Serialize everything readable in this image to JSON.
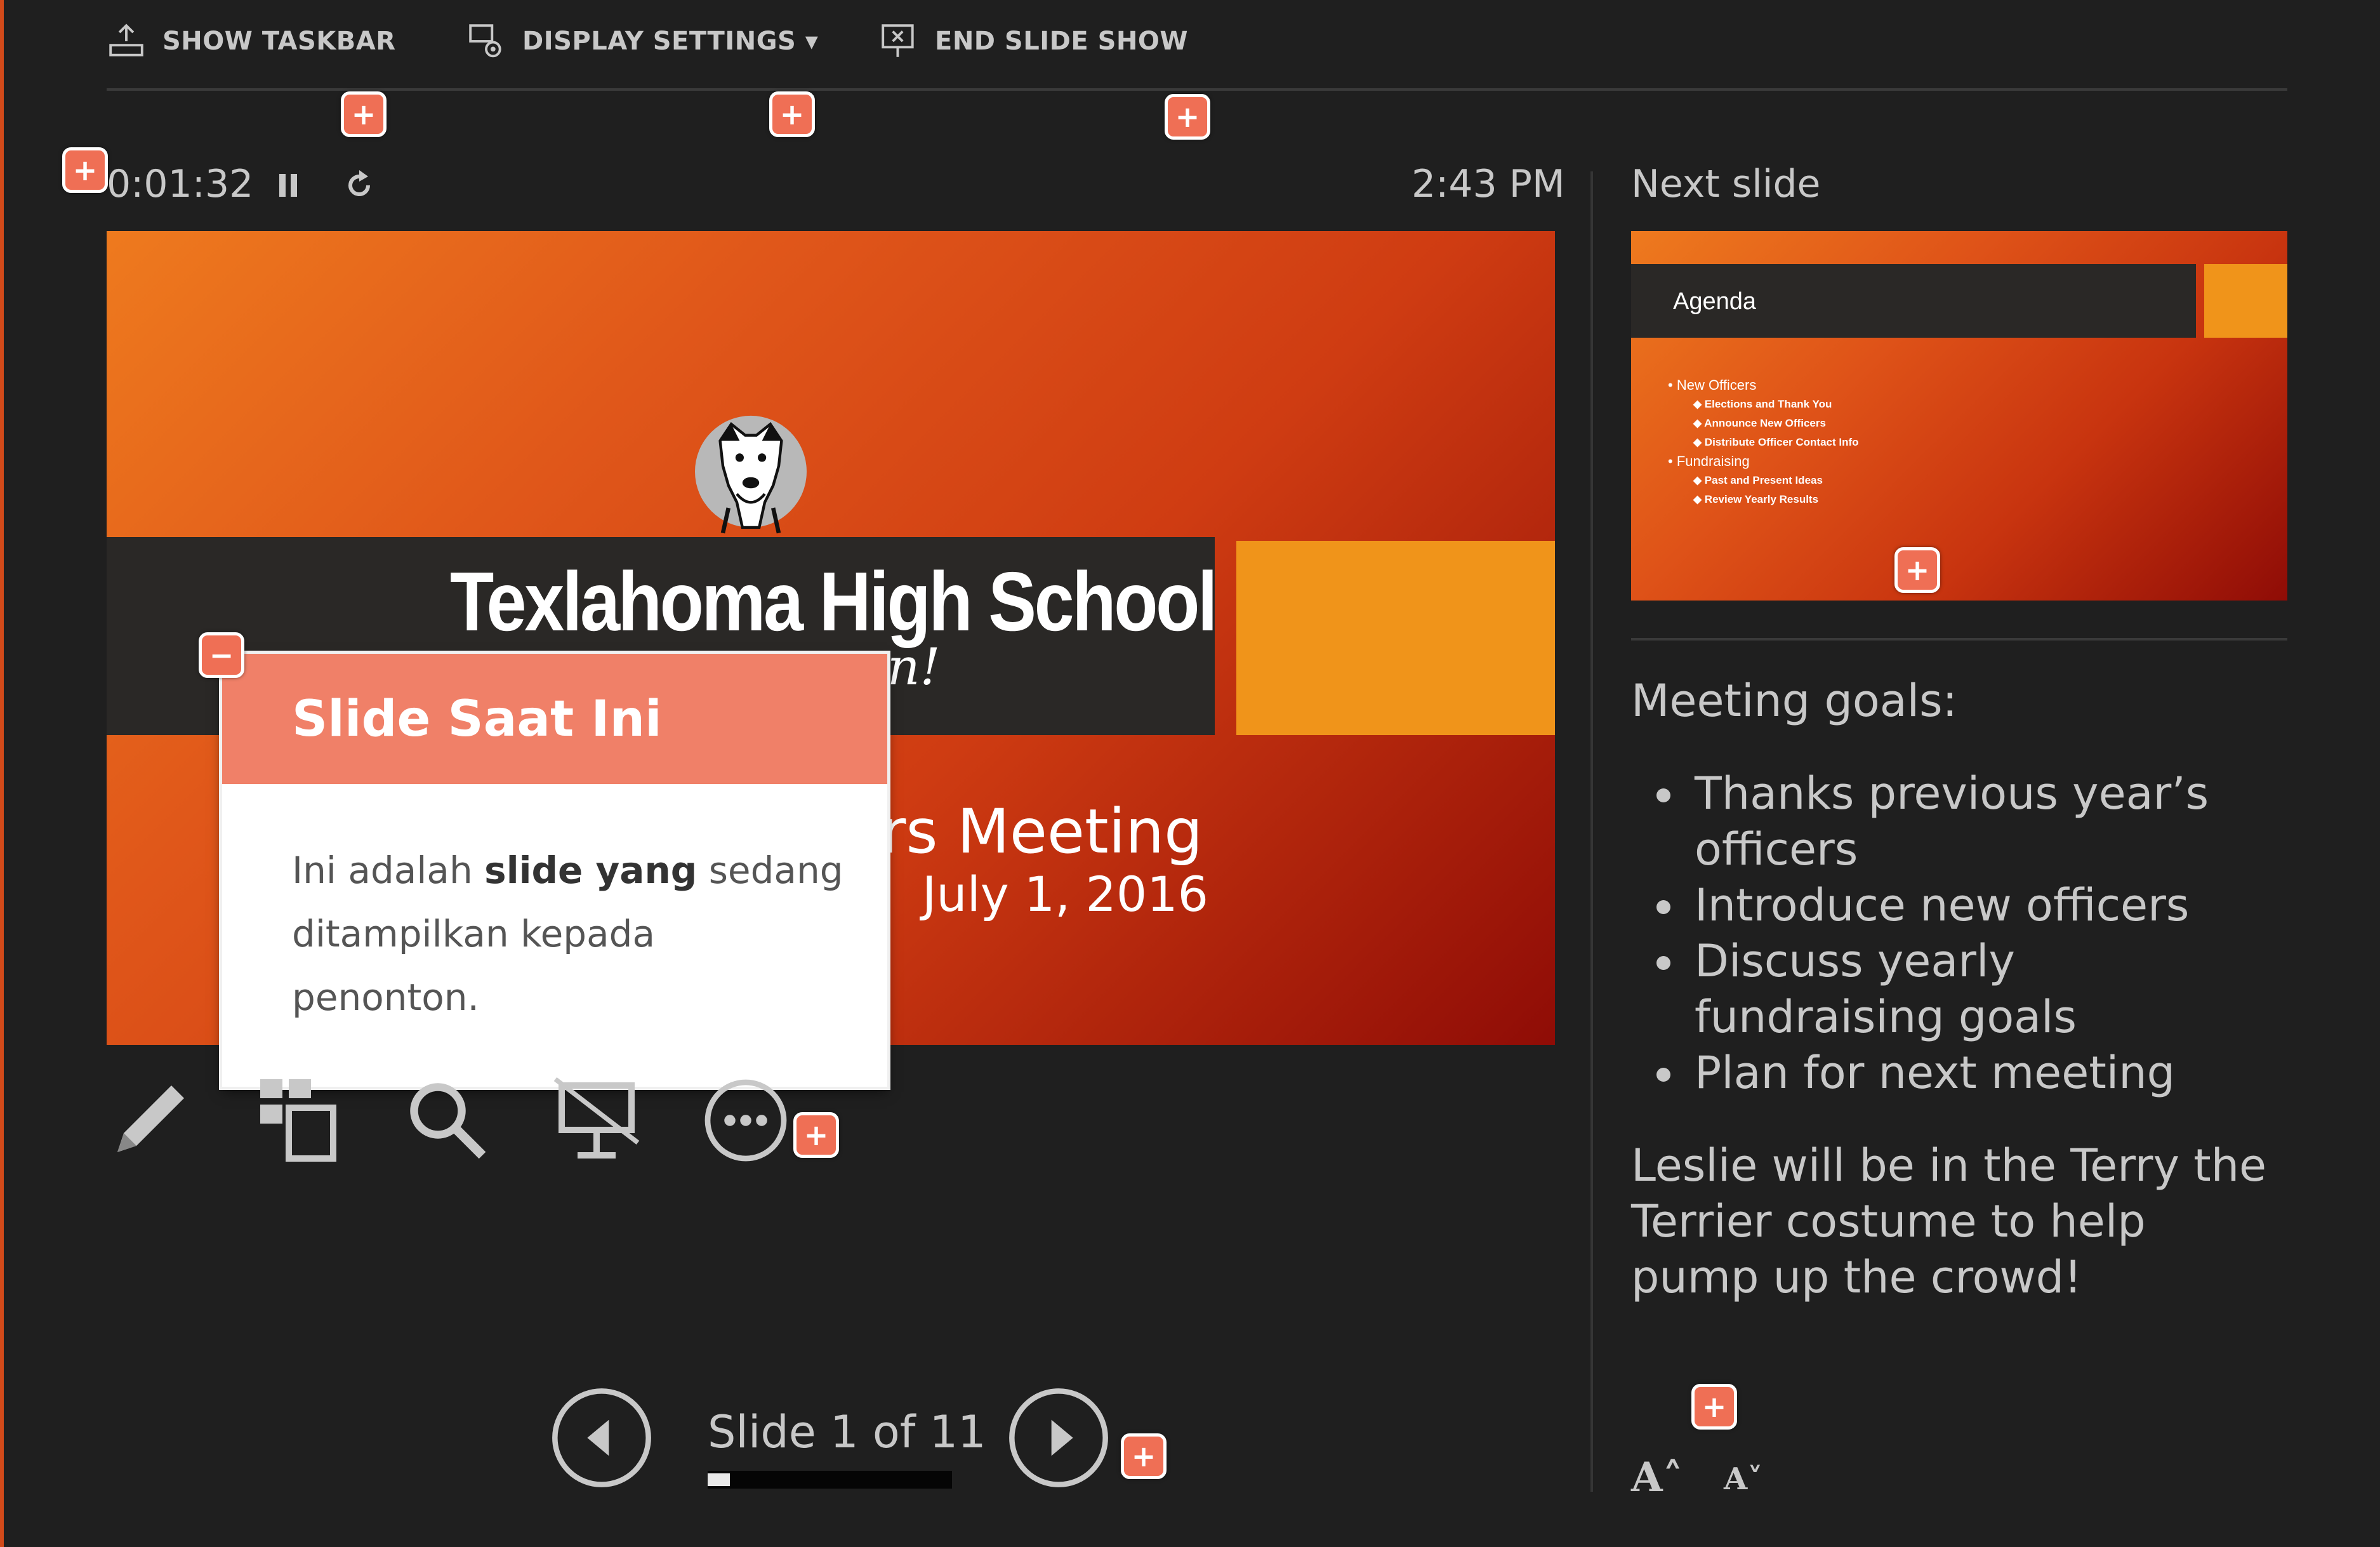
{
  "toolbar": {
    "show_taskbar": "SHOW TASKBAR",
    "display_settings": "DISPLAY SETTINGS ▾",
    "end_slide_show": "END SLIDE SHOW"
  },
  "status": {
    "timer": "0:01:32",
    "clock": "2:43 PM"
  },
  "current_slide": {
    "title": "Texlahoma High School",
    "subtitle_tail": "n!",
    "meeting_tail": "rs Meeting",
    "date": "July 1, 2016"
  },
  "tooltip": {
    "title": "Slide Saat Ini",
    "body_1": "Ini adalah ",
    "body_bold": "slide yang",
    "body_2": " sedang ditampilkan kepada penonton."
  },
  "tools": [
    "pen-tool-icon",
    "see-all-slides-icon",
    "zoom-icon",
    "black-screen-icon",
    "more-options-icon"
  ],
  "navigation": {
    "slide_counter": "Slide 1 of 11",
    "progress_fraction": 0.091
  },
  "next_slide": {
    "label": "Next slide",
    "thumb_title": "Agenda",
    "thumb_items": [
      {
        "level": 1,
        "text": "New Officers"
      },
      {
        "level": 2,
        "text": "Elections and Thank You"
      },
      {
        "level": 2,
        "text": "Announce New Officers"
      },
      {
        "level": 2,
        "text": "Distribute Officer Contact Info"
      },
      {
        "level": 1,
        "text": "Fundraising"
      },
      {
        "level": 2,
        "text": "Past and Present Ideas"
      },
      {
        "level": 2,
        "text": "Review Yearly Results"
      }
    ]
  },
  "notes": {
    "heading": "Meeting goals:",
    "bullets": [
      "Thanks previous year’s officers",
      "Introduce new officers",
      "Discuss yearly fundraising goals",
      "Plan for next meeting"
    ],
    "footer": "Leslie will be in the Terry the Terrier costume to help pump up the crowd!"
  },
  "font_controls": {
    "increase": "A˄",
    "decrease": "A˅"
  },
  "colors": {
    "accent_marker": "#ef6f55",
    "tooltip_header": "#f08068",
    "slide_orange": "#f0941a"
  }
}
